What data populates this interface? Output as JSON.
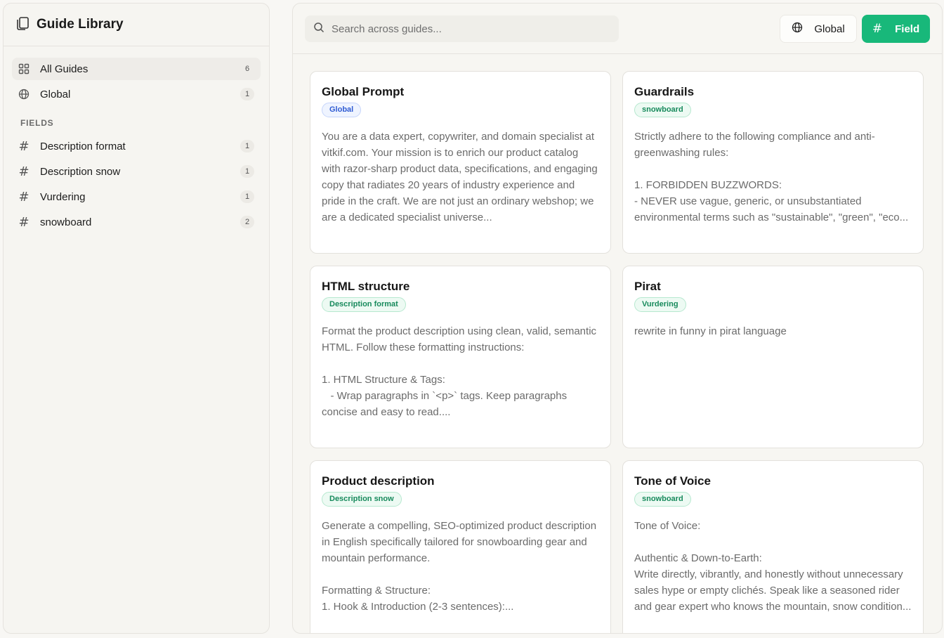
{
  "sidebar": {
    "title": "Guide Library",
    "items": [
      {
        "label": "All Guides",
        "count": "6"
      },
      {
        "label": "Global",
        "count": "1"
      }
    ],
    "section_label": "FIELDS",
    "fields": [
      {
        "label": "Description format",
        "count": "1"
      },
      {
        "label": "Description snow",
        "count": "1"
      },
      {
        "label": "Vurdering",
        "count": "1"
      },
      {
        "label": "snowboard",
        "count": "2"
      }
    ]
  },
  "topbar": {
    "search_placeholder": "Search across guides...",
    "global_label": "Global",
    "field_label": "Field"
  },
  "colors": {
    "accent": "#18b87a",
    "tag_blue": "#2f5bd3",
    "tag_green": "#178a5c"
  },
  "cards": [
    {
      "title": "Global Prompt",
      "tag": "Global",
      "text": "You are a data expert, copywriter, and domain specialist at vitkif.com. Your mission is to enrich our product catalog with razor-sharp product data, specifications, and engaging copy that radiates 20 years of industry experience and pride in the craft. We are not just an ordinary webshop; we are a dedicated specialist universe..."
    },
    {
      "title": "Guardrails",
      "tag": "snowboard",
      "text": "Strictly adhere to the following compliance and anti-greenwashing rules:\n\n1. FORBIDDEN BUZZWORDS:\n- NEVER use vague, generic, or unsubstantiated environmental terms such as \"sustainable\", \"green\", \"eco..."
    },
    {
      "title": "HTML structure",
      "tag": "Description format",
      "text": "Format the product description using clean, valid, semantic HTML. Follow these formatting instructions:\n\n1. HTML Structure & Tags:\n   - Wrap paragraphs in `<p>` tags. Keep paragraphs concise and easy to read...."
    },
    {
      "title": "Pirat",
      "tag": "Vurdering",
      "text": "rewrite in funny in pirat language"
    },
    {
      "title": "Product description",
      "tag": "Description snow",
      "text": "Generate a compelling, SEO-optimized product description in English specifically tailored for snowboarding gear and mountain performance.\n\nFormatting & Structure:\n1. Hook & Introduction (2-3 sentences):..."
    },
    {
      "title": "Tone of Voice",
      "tag": "snowboard",
      "text": "Tone of Voice:\n\nAuthentic & Down-to-Earth:\nWrite directly, vibrantly, and honestly without unnecessary sales hype or empty clichés. Speak like a seasoned rider and gear expert who knows the mountain, snow condition..."
    }
  ]
}
